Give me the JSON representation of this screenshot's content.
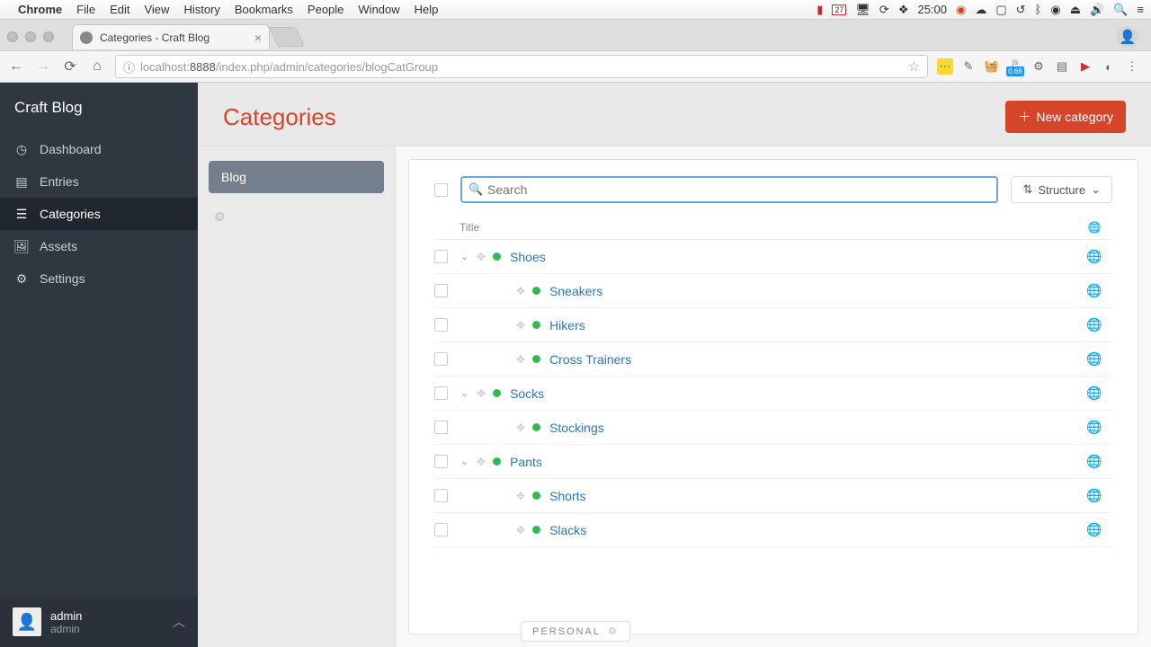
{
  "mac_menu": {
    "app": "Chrome",
    "items": [
      "File",
      "Edit",
      "View",
      "History",
      "Bookmarks",
      "People",
      "Window",
      "Help"
    ],
    "status_time": "25:00",
    "calendar_day": "27"
  },
  "browser": {
    "tab_title": "Categories - Craft Blog",
    "url_host": "localhost:",
    "url_port": "8888",
    "url_path": "/index.php/admin/categories/blogCatGroup",
    "ext_badge": "0.68"
  },
  "sidebar": {
    "site_name": "Craft Blog",
    "items": [
      {
        "label": "Dashboard",
        "icon": "◷"
      },
      {
        "label": "Entries",
        "icon": "▤"
      },
      {
        "label": "Categories",
        "icon": "☰",
        "active": true
      },
      {
        "label": "Assets",
        "icon": "🖼"
      },
      {
        "label": "Settings",
        "icon": "⚙"
      }
    ],
    "user": {
      "name": "admin",
      "role": "admin"
    }
  },
  "page": {
    "title": "Categories",
    "new_button": "New category",
    "group": "Blog",
    "search_placeholder": "Search",
    "sort_label": "Structure",
    "table_header": "Title"
  },
  "rows": [
    {
      "title": "Shoes",
      "level": 0,
      "expandable": true
    },
    {
      "title": "Sneakers",
      "level": 1,
      "expandable": false
    },
    {
      "title": "Hikers",
      "level": 1,
      "expandable": false
    },
    {
      "title": "Cross Trainers",
      "level": 1,
      "expandable": false
    },
    {
      "title": "Socks",
      "level": 0,
      "expandable": true
    },
    {
      "title": "Stockings",
      "level": 1,
      "expandable": false
    },
    {
      "title": "Pants",
      "level": 0,
      "expandable": true
    },
    {
      "title": "Shorts",
      "level": 1,
      "expandable": false
    },
    {
      "title": "Slacks",
      "level": 1,
      "expandable": false
    }
  ],
  "personal_label": "PERSONAL"
}
